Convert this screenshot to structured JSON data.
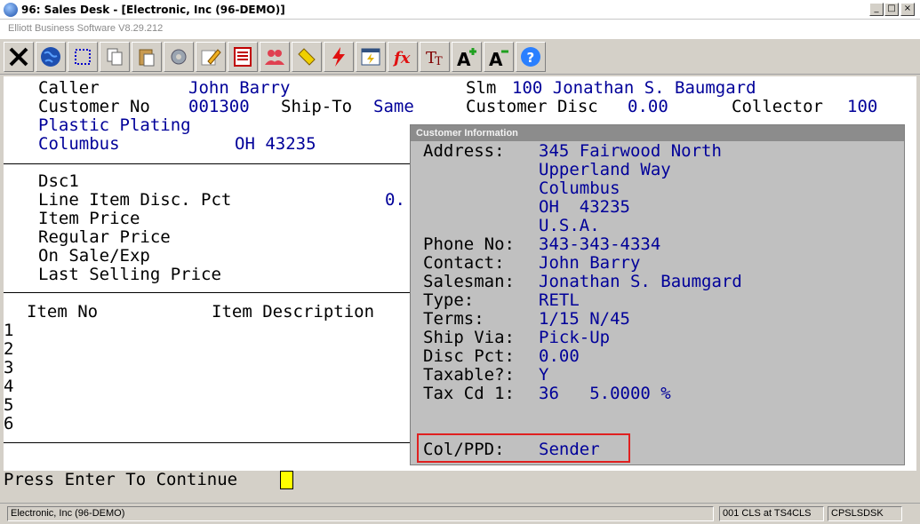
{
  "window": {
    "title": "96: Sales Desk - [Electronic, Inc (96-DEMO)]",
    "subtitle": "Elliott Business Software V8.29.212"
  },
  "toolbar": {
    "icons": [
      "close-icon",
      "globe-icon",
      "select-icon",
      "copy-icon",
      "paste-icon",
      "settings-icon",
      "edit-icon",
      "form-icon",
      "users-icon",
      "tag-icon",
      "lightning-icon",
      "calendar-icon",
      "fx-icon",
      "font-size-icon",
      "font-bigger-icon",
      "font-smaller-icon",
      "help-icon"
    ]
  },
  "header": {
    "caller_label": "Caller",
    "caller_value": "John Barry",
    "customer_no_label": "Customer No",
    "customer_no_value": "001300",
    "ship_to_label": "Ship-To",
    "ship_to_value": "Same",
    "company": "Plastic Plating",
    "city": "Columbus",
    "state_zip": "OH 43235",
    "slm_label": "Slm",
    "slm_value": "100 Jonathan S. Baumgard",
    "customer_disc_label": "Customer Disc",
    "customer_disc_value": "0.00",
    "collector_label": "Collector",
    "collector_value": "100"
  },
  "pricing": {
    "dsc1": "Dsc1",
    "line_item_disc_label": "Line Item Disc. Pct",
    "line_item_disc_value": "0.",
    "item_price": "Item Price",
    "regular_price": "Regular Price",
    "on_sale": "On Sale/Exp",
    "last_selling": "Last Selling Price"
  },
  "items": {
    "col_item_no": "Item No",
    "col_item_desc": "Item Description",
    "rows": [
      "1",
      "2",
      "3",
      "4",
      "5",
      "6"
    ]
  },
  "popup": {
    "title": "Customer Information",
    "address_label": "Address:",
    "address_lines": [
      "345 Fairwood North",
      "Upperland Way",
      "Columbus",
      "OH  43235",
      "U.S.A."
    ],
    "phone_label": "Phone No:",
    "phone_value": "343-343-4334",
    "contact_label": "Contact:",
    "contact_value": "John Barry",
    "salesman_label": "Salesman:",
    "salesman_value": "Jonathan S. Baumgard",
    "type_label": "Type:",
    "type_value": "RETL",
    "terms_label": "Terms:",
    "terms_value": "1/15 N/45",
    "ship_via_label": "Ship Via:",
    "ship_via_value": "Pick-Up",
    "disc_label": "Disc Pct:",
    "disc_value": "0.00",
    "taxable_label": "Taxable?:",
    "taxable_value": "Y",
    "tax_cd_label": "Tax Cd 1:",
    "tax_cd_value": "36   5.0000 %",
    "colppd_label": "Col/PPD:",
    "colppd_value": "Sender"
  },
  "prompt": "Press Enter To Continue",
  "statusbar": {
    "company": "Electronic, Inc (96-DEMO)",
    "session": "001 CLS at TS4CLS",
    "program": "CPSLSDSK"
  },
  "colors": {
    "field_blue": "#000099",
    "highlight_red": "#e02020",
    "cursor_yellow": "#ffff00"
  }
}
